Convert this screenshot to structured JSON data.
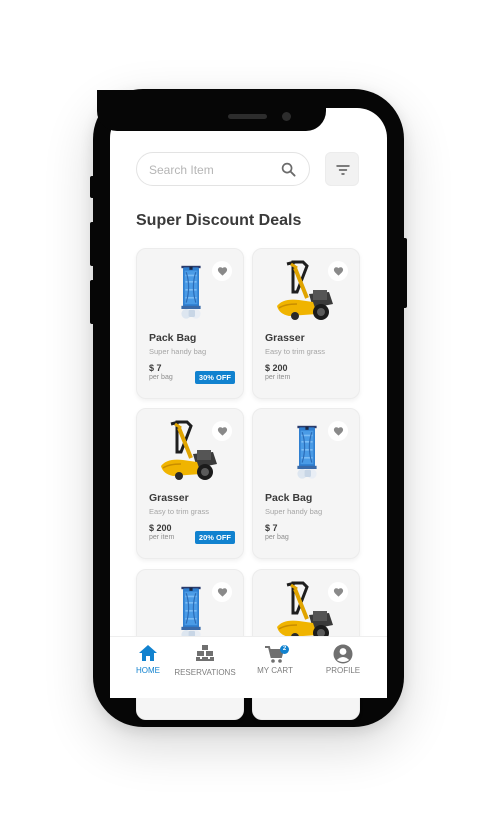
{
  "search": {
    "placeholder": "Search Item"
  },
  "section_title": "Super Discount Deals",
  "products": [
    {
      "name": "Pack Bag",
      "description": "Super handy bag",
      "price": "$ 7",
      "unit": "per bag",
      "discount": "30% OFF",
      "image": "pack-bag"
    },
    {
      "name": "Grasser",
      "description": "Easy to trim grass",
      "price": "$ 200",
      "unit": "per item",
      "discount": "",
      "image": "grasser"
    },
    {
      "name": "Grasser",
      "description": "Easy to trim grass",
      "price": "$ 200",
      "unit": "per item",
      "discount": "20% OFF",
      "image": "grasser"
    },
    {
      "name": "Pack Bag",
      "description": "Super handy bag",
      "price": "$ 7",
      "unit": "per bag",
      "discount": "",
      "image": "pack-bag"
    },
    {
      "name": "",
      "description": "",
      "price": "",
      "unit": "",
      "discount": "",
      "image": "pack-bag"
    },
    {
      "name": "",
      "description": "",
      "price": "",
      "unit": "",
      "discount": "",
      "image": "grasser"
    }
  ],
  "tabs": [
    {
      "label": "HOME",
      "icon": "home-icon",
      "active": true
    },
    {
      "label": "RESERVATIONS",
      "icon": "warehouse-icon",
      "active": false
    },
    {
      "label": "MY CART",
      "icon": "cart-icon",
      "active": false,
      "badge": "2"
    },
    {
      "label": "PROFILE",
      "icon": "profile-icon",
      "active": false
    }
  ],
  "colors": {
    "accent": "#1182cf",
    "text": "#3a3a3a",
    "muted": "#a5a5a5",
    "card_bg": "#f5f5f5",
    "phone_frame": "#060606"
  }
}
